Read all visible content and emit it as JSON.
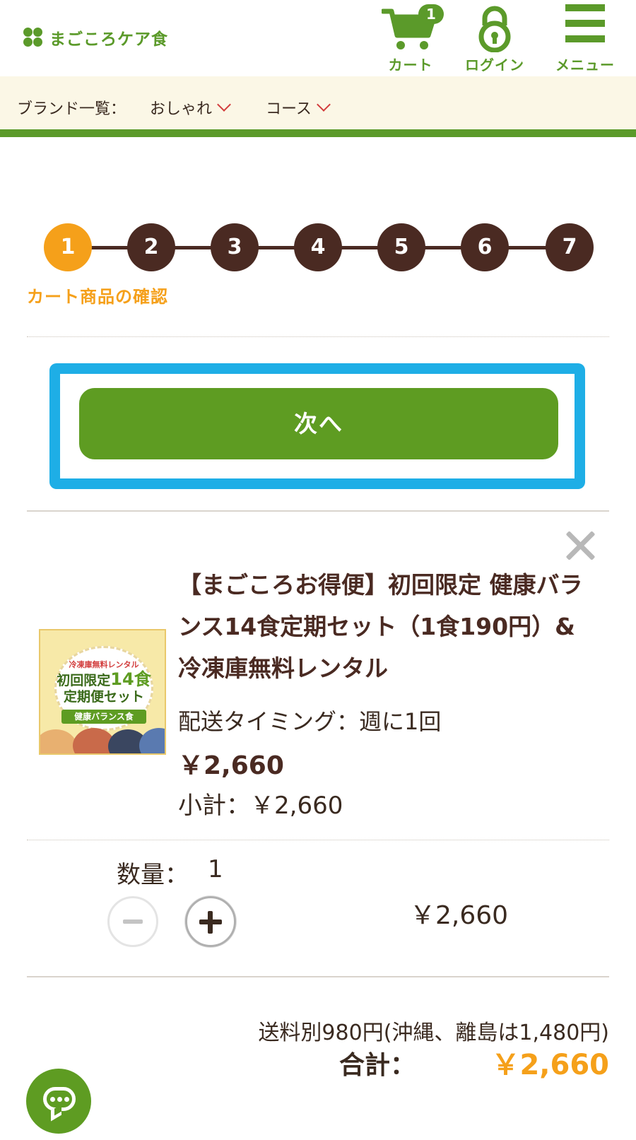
{
  "header": {
    "logo_text": "まごころケア食",
    "cart_label": "カート",
    "cart_count": "1",
    "login_label": "ログイン",
    "menu_label": "メニュー"
  },
  "brandbar": {
    "label": "ブランド一覧：",
    "items": [
      "おしゃれ",
      "コース"
    ]
  },
  "steps": {
    "numbers": [
      "1",
      "2",
      "3",
      "4",
      "5",
      "6",
      "7"
    ],
    "active_index": 0,
    "current_label": "カート商品の確認"
  },
  "next_button_label": "次へ",
  "product": {
    "image_text_1": "冷凍庫無料レンタル",
    "image_text_2": "初回限定",
    "image_text_2_big": "14食",
    "image_text_3": "定期便セット",
    "image_text_4": "健康バランス食",
    "title": "【まごころお得便】初回限定 健康バランス14食定期セット（1食190円）&冷凍庫無料レンタル",
    "timing": "配送タイミング：週に1回",
    "price": "￥2,660",
    "subtotal": "小計：￥2,660"
  },
  "quantity": {
    "label": "数量：",
    "value": "1",
    "line_total": "￥2,660"
  },
  "totals": {
    "shipping_note": "送料別980円(沖縄、離島は1,480円)",
    "total_label": "合計：",
    "total_value": "￥2,660"
  },
  "colors": {
    "brand_green": "#5e9c22",
    "accent_orange": "#f5a01a",
    "step_dark": "#4a2a22",
    "highlight_blue": "#1eaee6"
  },
  "icons": {
    "cart": "cart-icon",
    "login": "lock-icon",
    "menu": "hamburger-icon",
    "close": "close-icon",
    "chat": "chat-icon"
  }
}
